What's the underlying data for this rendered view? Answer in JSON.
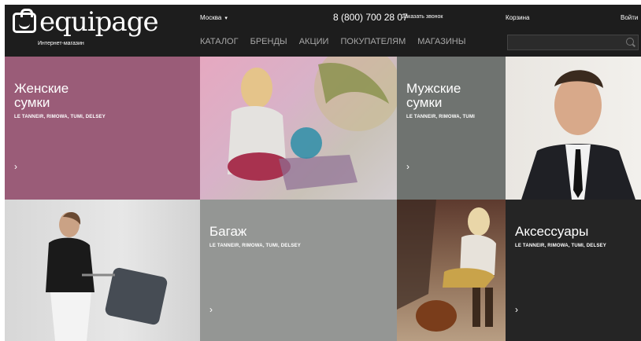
{
  "header": {
    "logo_text": "equipage",
    "tagline": "Интернет-магазин",
    "city": "Москва",
    "phone": "8 (800) 700 28 07",
    "callback": "Заказать звонок",
    "cart": "Корзина",
    "login": "Войти",
    "nav": [
      "КАТАЛОГ",
      "БРЕНДЫ",
      "АКЦИИ",
      "ПОКУПАТЕЛЯМ",
      "МАГАЗИНЫ"
    ],
    "search_placeholder": ""
  },
  "tiles": [
    {
      "title": "Женские\nсумки",
      "brands": "LE TANNEIR, RIMOWA, TUMI, DELSEY",
      "chevron": "›"
    },
    {
      "title": "Мужские\nсумки",
      "brands": "LE TANNEIR, RIMOWA, TUMI",
      "chevron": "›"
    },
    {
      "title": "Багаж",
      "brands": "LE TANNEIR, RIMOWA, TUMI, DELSEY",
      "chevron": "›"
    },
    {
      "title": "Аксессуары",
      "brands": "LE TANNEIR, RIMOWA, TUMI, DELSEY",
      "chevron": "›"
    }
  ],
  "colors": {
    "header_bg": "#1d1d1d",
    "womens_bg": "#9a5c78",
    "mens_bg": "#6f7370",
    "luggage_bg": "#949694",
    "accessories_bg": "#252525"
  }
}
